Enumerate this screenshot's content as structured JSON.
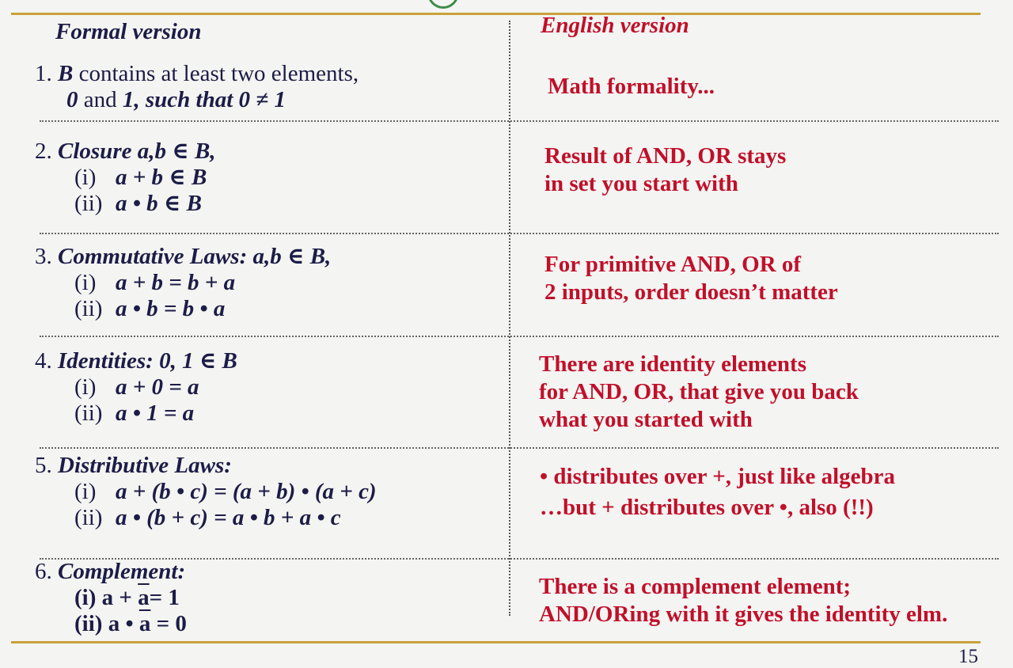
{
  "slide": {
    "page_number": "15",
    "headers": {
      "formal": "Formal version",
      "english": "English version"
    },
    "rows": [
      {
        "num": "1.",
        "formal_line1_a": "B",
        "formal_line1_b": " contains at least two elements,",
        "formal_line2_a": "0",
        "formal_line2_b": " and ",
        "formal_line2_c": "1,  such that 0 ≠ 1",
        "english": [
          "Math formality..."
        ]
      },
      {
        "num": "2.",
        "title": "Closure",
        "title_rest": "  a,b ∈ B,",
        "items": [
          {
            "roman": "(i)",
            "expr": "a + b ∈ B"
          },
          {
            "roman": "(ii)",
            "expr": "a • b ∈ B"
          }
        ],
        "english": [
          "Result of AND, OR stays",
          "in set you start with"
        ]
      },
      {
        "num": "3.",
        "title": "Commutative Laws",
        "title_rest": ": a,b ∈ B,",
        "items": [
          {
            "roman": "(i)",
            "expr": "a + b = b + a"
          },
          {
            "roman": "(ii)",
            "expr": "a • b = b • a"
          }
        ],
        "english": [
          "For primitive AND, OR of",
          "2 inputs, order doesn’t matter"
        ]
      },
      {
        "num": "4.",
        "title": "Identities",
        "title_rest": ": 0, 1 ∈ B",
        "items": [
          {
            "roman": "(i)",
            "expr": "a + 0 = a"
          },
          {
            "roman": "(ii)",
            "expr": "a • 1 = a"
          }
        ],
        "english": [
          "There are identity elements",
          "for AND, OR, that give you back",
          "what you started with"
        ]
      },
      {
        "num": "5.",
        "title": "Distributive Laws",
        "title_rest": ":",
        "items": [
          {
            "roman": "(i)",
            "expr": "a + (b • c) = (a + b) • (a + c)"
          },
          {
            "roman": "(ii)",
            "expr": "a • (b + c) = a • b  +  a • c"
          }
        ],
        "english": [
          "•  distributes over +, just like algebra",
          "…but + distributes over •, also (!!)"
        ]
      },
      {
        "num": "6.",
        "title": "Complement",
        "title_rest": ":",
        "items": [
          {
            "roman": "(i)",
            "pre": "a + ",
            "bar": "a",
            "post": "= 1"
          },
          {
            "roman": "(ii)",
            "pre": "a • ",
            "bar": "a",
            "post": " = 0"
          }
        ],
        "english": [
          "There is a complement element;",
          "AND/ORing with it gives the identity elm."
        ]
      }
    ]
  }
}
